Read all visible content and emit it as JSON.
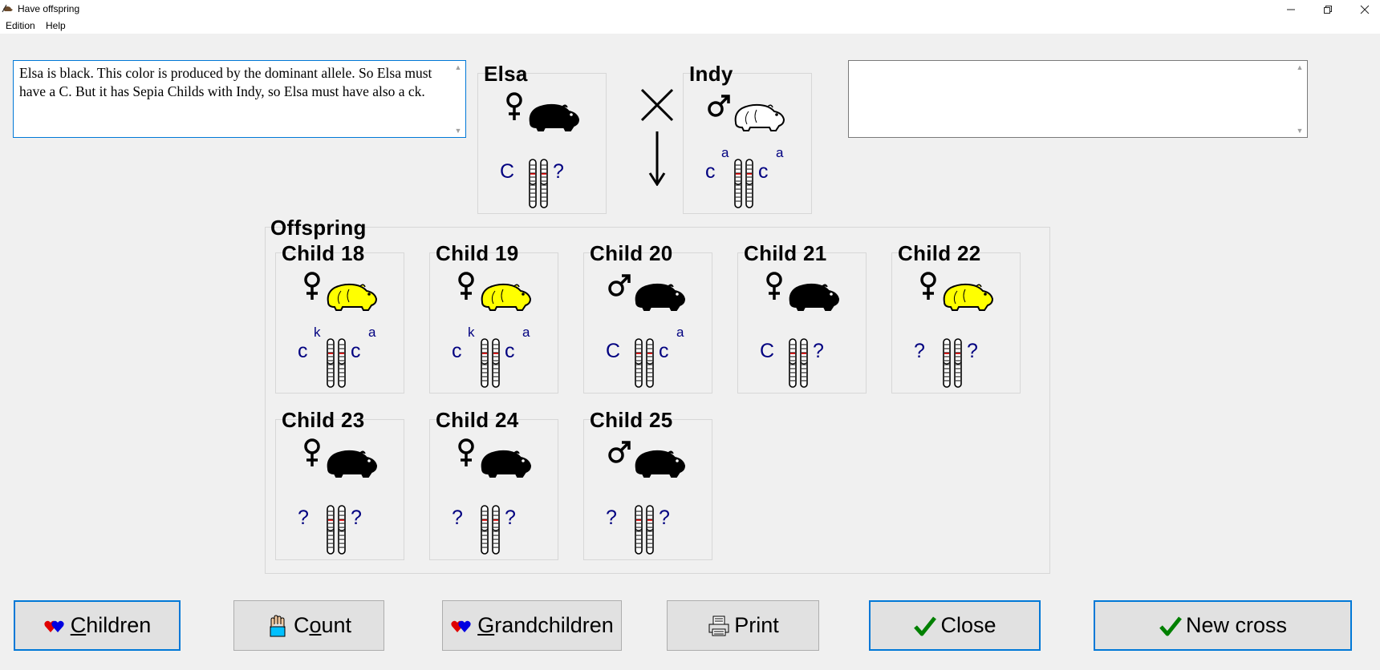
{
  "window": {
    "title": "Have offspring"
  },
  "menu": [
    "Edition",
    "Help"
  ],
  "notes": {
    "left_text": "Elsa is black. This color is produced by the dominant allele. So Elsa must have a C. But it has Sepia Childs with Indy, so Elsa must have also a ck.",
    "right_text": ""
  },
  "parents": [
    {
      "name": "Elsa",
      "sex": "female",
      "color": "#000000",
      "allele1": "C",
      "allele1_sup": "",
      "allele2": "?",
      "allele2_sup": ""
    },
    {
      "name": "Indy",
      "sex": "male",
      "color": "#ffffff",
      "allele1": "c",
      "allele1_sup": "a",
      "allele2": "c",
      "allele2_sup": "a"
    }
  ],
  "offspring": {
    "title": "Offspring",
    "children": [
      {
        "name": "Child 18",
        "sex": "female",
        "color": "#ffff00",
        "allele1": "c",
        "allele1_sup": "k",
        "allele2": "c",
        "allele2_sup": "a"
      },
      {
        "name": "Child 19",
        "sex": "female",
        "color": "#ffff00",
        "allele1": "c",
        "allele1_sup": "k",
        "allele2": "c",
        "allele2_sup": "a"
      },
      {
        "name": "Child 20",
        "sex": "male",
        "color": "#000000",
        "allele1": "C",
        "allele1_sup": "",
        "allele2": "c",
        "allele2_sup": "a"
      },
      {
        "name": "Child 21",
        "sex": "female",
        "color": "#000000",
        "allele1": "C",
        "allele1_sup": "",
        "allele2": "?",
        "allele2_sup": ""
      },
      {
        "name": "Child 22",
        "sex": "female",
        "color": "#ffff00",
        "allele1": "?",
        "allele1_sup": "",
        "allele2": "?",
        "allele2_sup": ""
      },
      {
        "name": "Child 23",
        "sex": "female",
        "color": "#000000",
        "allele1": "?",
        "allele1_sup": "",
        "allele2": "?",
        "allele2_sup": ""
      },
      {
        "name": "Child 24",
        "sex": "female",
        "color": "#000000",
        "allele1": "?",
        "allele1_sup": "",
        "allele2": "?",
        "allele2_sup": ""
      },
      {
        "name": "Child 25",
        "sex": "male",
        "color": "#000000",
        "allele1": "?",
        "allele1_sup": "",
        "allele2": "?",
        "allele2_sup": ""
      }
    ]
  },
  "buttons": {
    "children": {
      "accel": "C",
      "rest": "hildren",
      "icon": "hearts-icon"
    },
    "count": {
      "accel": "o",
      "pre": "C",
      "rest": "unt",
      "icon": "counting-hand-icon"
    },
    "grandchildren": {
      "accel": "G",
      "rest": "randchildren",
      "icon": "hearts-icon"
    },
    "print": {
      "label": "Print",
      "icon": "printer-icon"
    },
    "close": {
      "label": "Close",
      "icon": "checkmark-icon"
    },
    "new_cross": {
      "label": "New cross",
      "icon": "checkmark-icon"
    }
  },
  "colors": {
    "allele": "#000080",
    "focus": "#0078d7",
    "check": "#008000"
  }
}
